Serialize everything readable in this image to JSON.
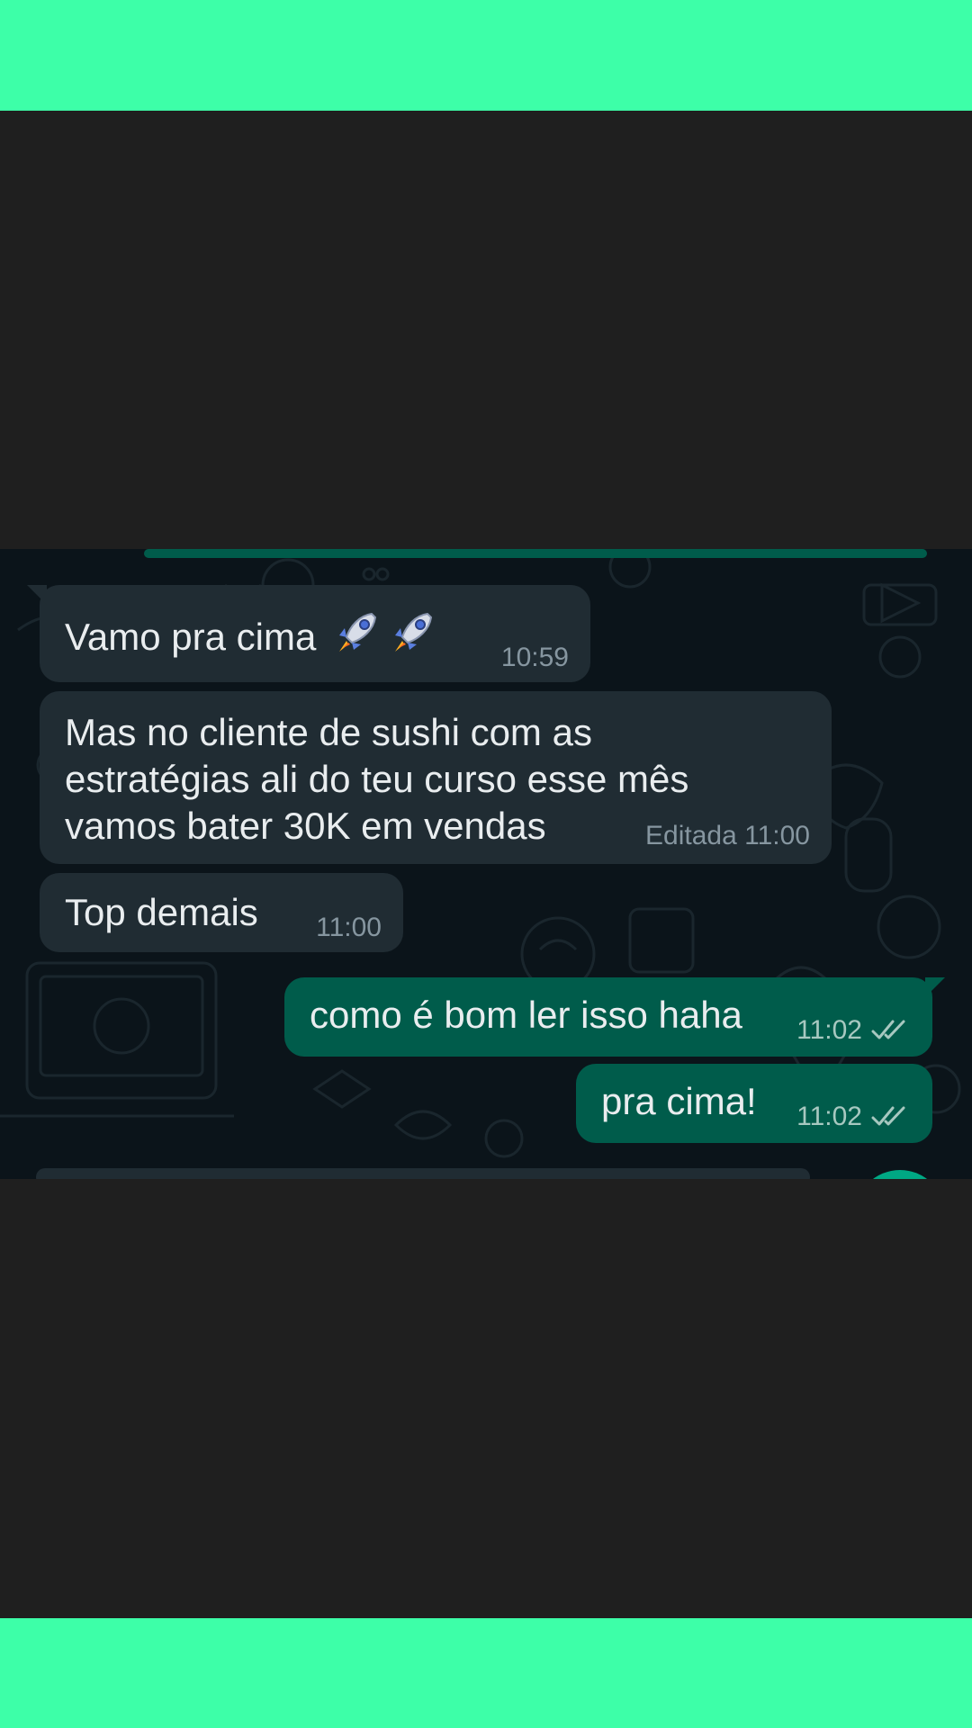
{
  "colors": {
    "accent_band": "#3dffa8",
    "chat_background": "#0b141a",
    "incoming_bubble": "#202c33",
    "outgoing_bubble": "#005c4b",
    "text": "#e9edef",
    "meta_text": "#8696a0",
    "read_ticks": "#a7c8c0"
  },
  "messages": [
    {
      "direction": "incoming",
      "text": "Vamo pra cima",
      "emoji": [
        "rocket-icon",
        "rocket-icon"
      ],
      "time": "10:59"
    },
    {
      "direction": "incoming",
      "lines": [
        "Mas no cliente de sushi com as",
        "estratégias ali do teu curso esse mês",
        "vamos bater 30K em vendas"
      ],
      "edited_label": "Editada",
      "time": "11:00"
    },
    {
      "direction": "incoming",
      "text": "Top demais",
      "time": "11:00"
    },
    {
      "direction": "outgoing",
      "text": "como é bom ler isso haha",
      "time": "11:02",
      "status": "double-check-icon"
    },
    {
      "direction": "outgoing",
      "text": "pra cima!",
      "time": "11:02",
      "status": "double-check-icon"
    }
  ]
}
